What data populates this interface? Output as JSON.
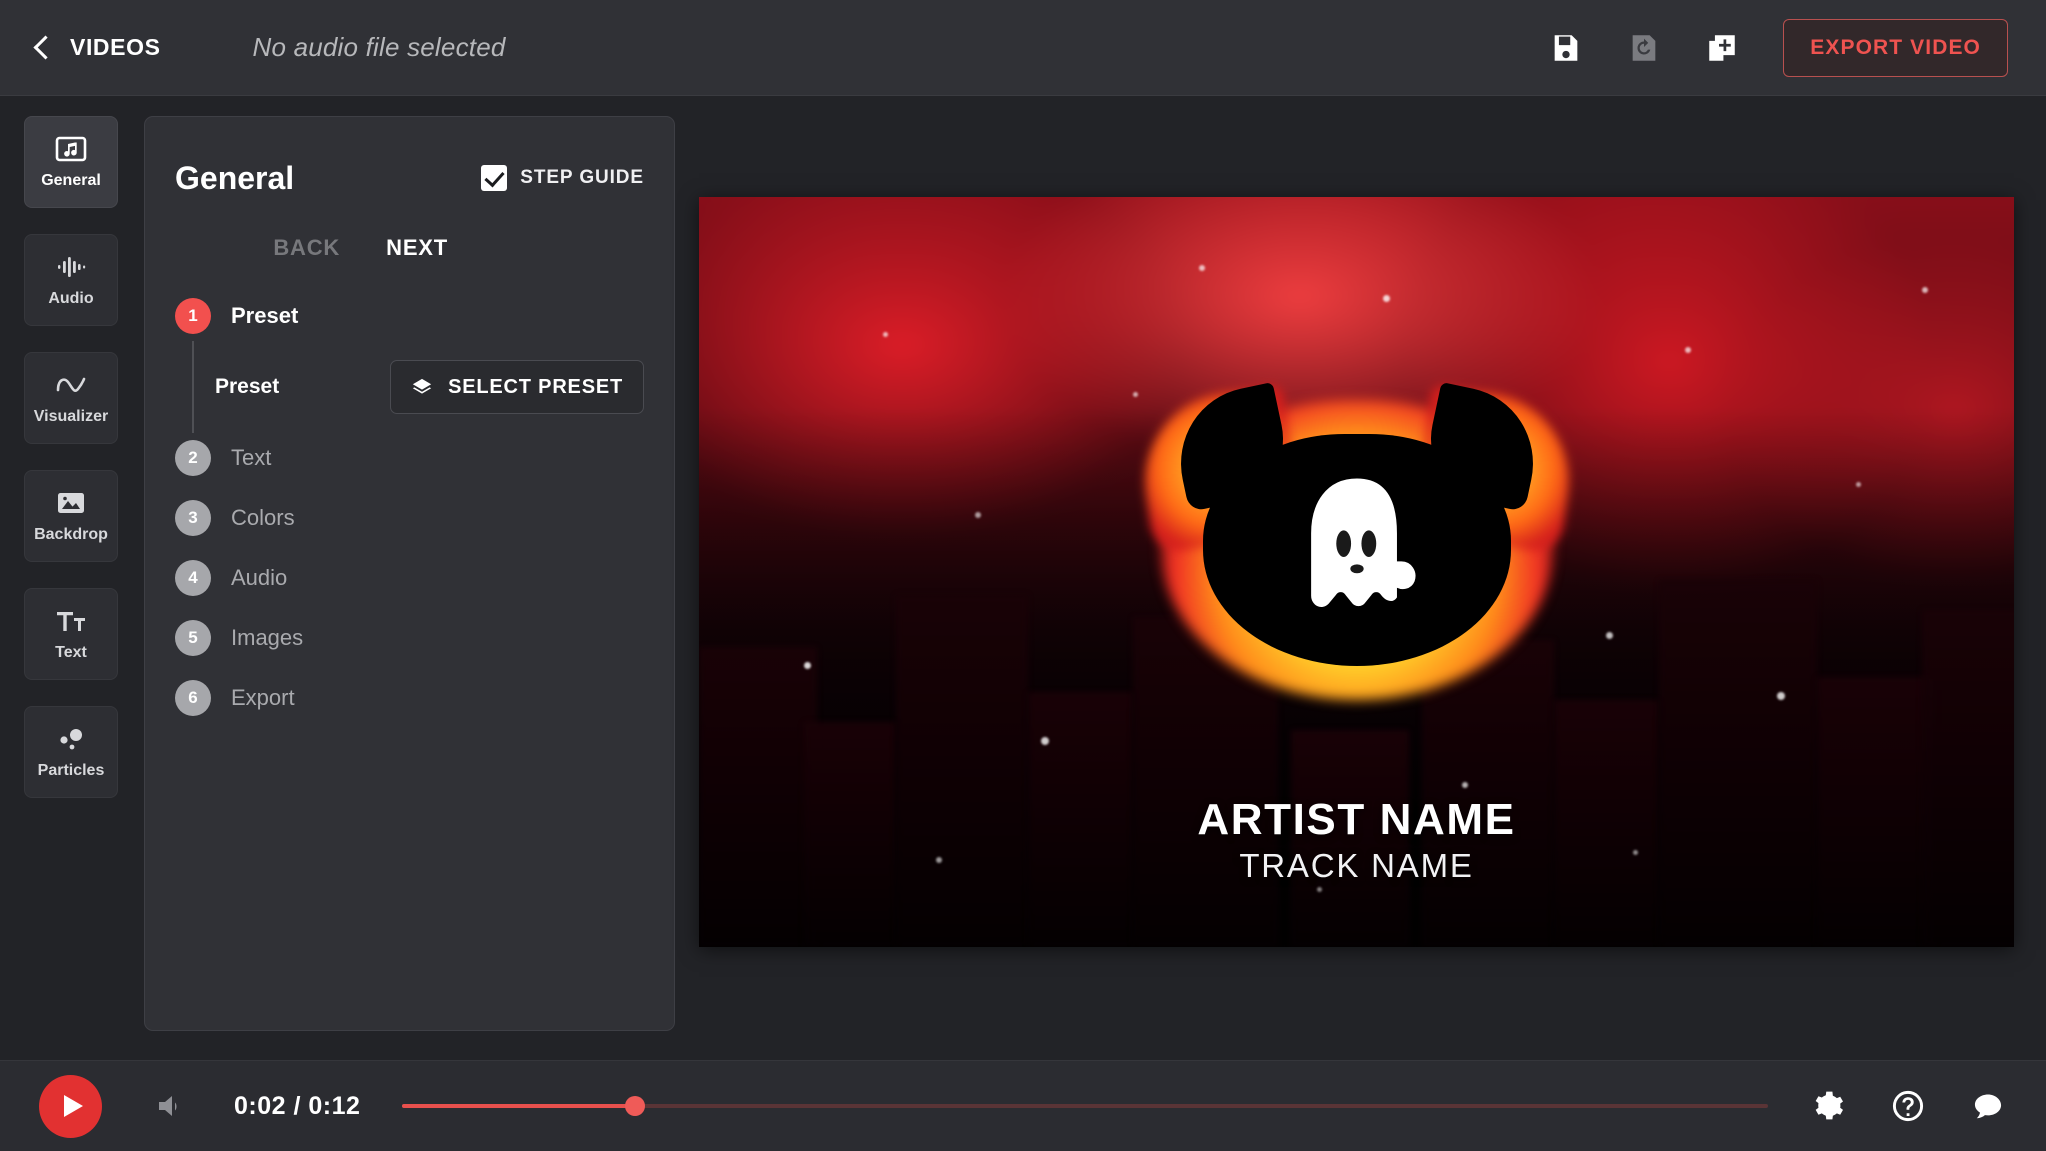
{
  "topbar": {
    "back_icon": "chevron-left-icon",
    "back_label": "VIDEOS",
    "audio_status": "No audio file selected",
    "actions": [
      {
        "name": "save-icon",
        "label": "Save",
        "state": "enabled"
      },
      {
        "name": "revert-icon",
        "label": "Revert",
        "state": "disabled"
      },
      {
        "name": "duplicate-add-icon",
        "label": "New",
        "state": "enabled"
      }
    ],
    "export_label": "EXPORT VIDEO",
    "export_color": "#ef5350"
  },
  "sidebar": {
    "items": [
      {
        "label": "General",
        "icon": "music-note-frame-icon",
        "active": true
      },
      {
        "label": "Audio",
        "icon": "waveform-icon",
        "active": false
      },
      {
        "label": "Visualizer",
        "icon": "sine-wave-icon",
        "active": false
      },
      {
        "label": "Backdrop",
        "icon": "image-mountain-icon",
        "active": false
      },
      {
        "label": "Text",
        "icon": "text-size-icon",
        "active": false
      },
      {
        "label": "Particles",
        "icon": "particles-dots-icon",
        "active": false
      }
    ]
  },
  "panel": {
    "title": "General",
    "step_guide": {
      "label": "STEP GUIDE",
      "checked": true
    },
    "nav": {
      "back": "BACK",
      "next": "NEXT"
    },
    "steps": [
      {
        "num": "1",
        "label": "Preset",
        "current": true
      },
      {
        "num": "2",
        "label": "Text",
        "current": false
      },
      {
        "num": "3",
        "label": "Colors",
        "current": false
      },
      {
        "num": "4",
        "label": "Audio",
        "current": false
      },
      {
        "num": "5",
        "label": "Images",
        "current": false
      },
      {
        "num": "6",
        "label": "Export",
        "current": false
      }
    ],
    "substep": {
      "label": "Preset",
      "button_label": "SELECT PRESET",
      "button_icon": "layers-icon"
    },
    "accent_current": "#f2504e",
    "accent_inactive": "#a6a7ab"
  },
  "preview": {
    "artist_name": "ARTIST NAME",
    "track_name": "TRACK NAME",
    "visualizer_icon": "ghost-icon",
    "backdrop": "blurred-red-city-skyline"
  },
  "player": {
    "play_icon": "play-icon",
    "volume_icon": "volume-icon",
    "current_time": "0:02",
    "total_time": "0:12",
    "time_display": "0:02 / 0:12",
    "progress_percent": 17,
    "accent": "#e8504d",
    "right_icons": [
      {
        "name": "gear-icon",
        "label": "Settings"
      },
      {
        "name": "help-icon",
        "label": "Help"
      },
      {
        "name": "chat-icon",
        "label": "Feedback"
      }
    ]
  }
}
